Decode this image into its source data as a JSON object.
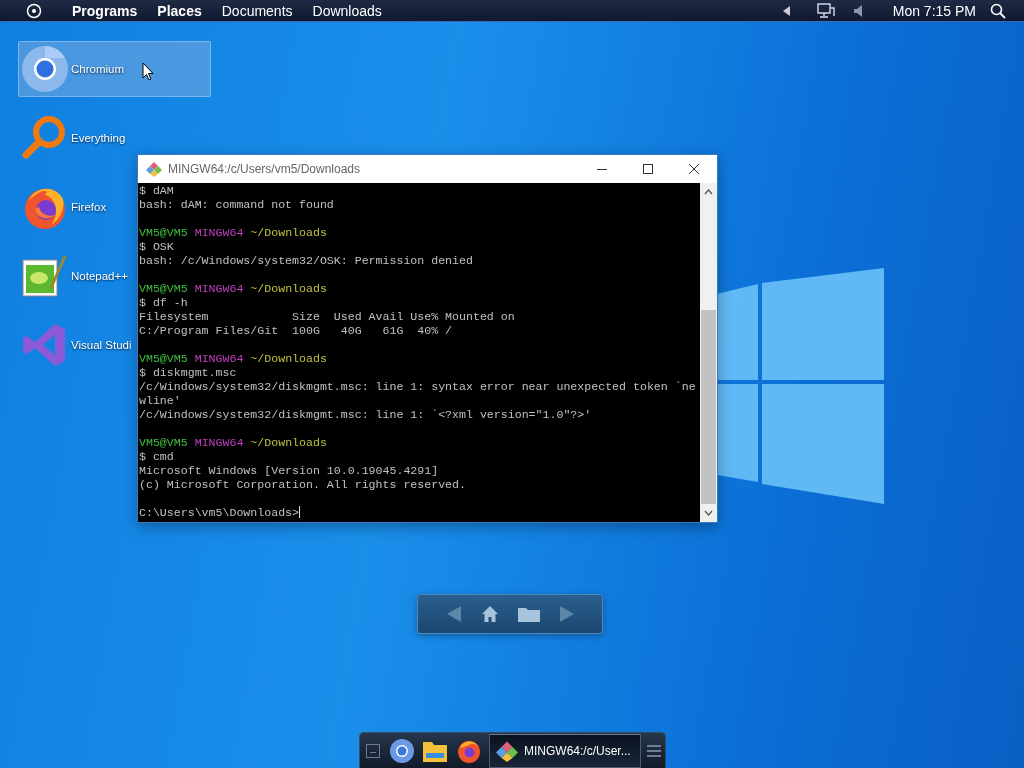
{
  "top_panel": {
    "items": [
      {
        "kind": "menu",
        "label": "Programs"
      },
      {
        "kind": "menu",
        "label": "Places"
      },
      {
        "kind": "bookmark",
        "label": "Documents"
      },
      {
        "kind": "bookmark",
        "label": "Downloads"
      }
    ],
    "clock": "Mon 7:15 PM"
  },
  "desktop_icons": [
    {
      "kind": "chromium",
      "label": "Chromium",
      "selected": true
    },
    {
      "kind": "magnifier",
      "label": "Everything",
      "selected": false
    },
    {
      "kind": "firefox",
      "label": "Firefox",
      "selected": false
    },
    {
      "kind": "notepad",
      "label": "Notepad++",
      "selected": false
    },
    {
      "kind": "studio",
      "label": "Visual Studi",
      "selected": false
    }
  ],
  "terminal": {
    "title": "MINGW64:/c/Users/vm5/Downloads",
    "lines": [
      {
        "kind": "text",
        "text": "$ dAM"
      },
      {
        "kind": "text",
        "text": "bash: dAM: command not found"
      },
      {
        "kind": "blank"
      },
      {
        "kind": "prompt",
        "user": "VM5@VM5",
        "shell": "MINGW64",
        "path": "~/Downloads"
      },
      {
        "kind": "text",
        "text": "$ OSK"
      },
      {
        "kind": "text",
        "text": "bash: /c/Windows/system32/OSK: Permission denied"
      },
      {
        "kind": "blank"
      },
      {
        "kind": "prompt",
        "user": "VM5@VM5",
        "shell": "MINGW64",
        "path": "~/Downloads"
      },
      {
        "kind": "text",
        "text": "$ df -h"
      },
      {
        "kind": "text",
        "text": "Filesystem            Size  Used Avail Use% Mounted on"
      },
      {
        "kind": "text",
        "text": "C:/Program Files/Git  100G   40G   61G  40% /"
      },
      {
        "kind": "blank"
      },
      {
        "kind": "prompt",
        "user": "VM5@VM5",
        "shell": "MINGW64",
        "path": "~/Downloads"
      },
      {
        "kind": "text",
        "text": "$ diskmgmt.msc"
      },
      {
        "kind": "text",
        "text": "/c/Windows/system32/diskmgmt.msc: line 1: syntax error near unexpected token `ne"
      },
      {
        "kind": "text",
        "text": "wline'"
      },
      {
        "kind": "text",
        "text": "/c/Windows/system32/diskmgmt.msc: line 1: `<?xml version=\"1.0\"?>'"
      },
      {
        "kind": "blank"
      },
      {
        "kind": "prompt",
        "user": "VM5@VM5",
        "shell": "MINGW64",
        "path": "~/Downloads"
      },
      {
        "kind": "text",
        "text": "$ cmd"
      },
      {
        "kind": "text",
        "text": "Microsoft Windows [Version 10.0.19045.4291]"
      },
      {
        "kind": "text",
        "text": "(c) Microsoft Corporation. All rights reserved."
      },
      {
        "kind": "blank"
      },
      {
        "kind": "input",
        "text": "C:\\Users\\vm5\\Downloads>"
      }
    ]
  },
  "taskbar": {
    "tasks": [
      {
        "label": "MINGW64:/c/User...",
        "selected": true
      }
    ]
  }
}
